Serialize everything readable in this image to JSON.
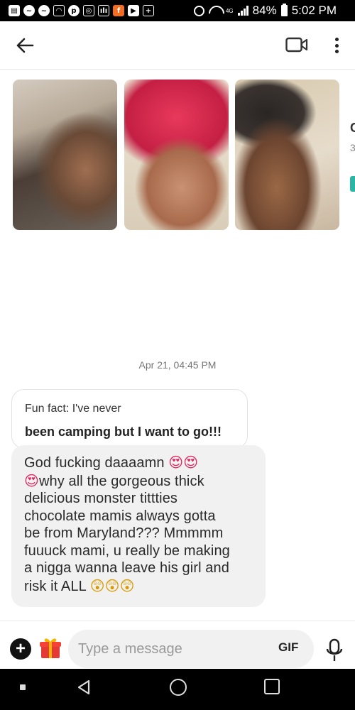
{
  "status_bar": {
    "battery": "84%",
    "time": "5:02 PM",
    "network_badge": "4G"
  },
  "header": {
    "back_icon": "arrow-left-icon",
    "video_icon": "video-camera-icon",
    "more_icon": "more-vertical-icon"
  },
  "profile": {
    "photos": [
      "photo-1",
      "photo-2",
      "photo-3"
    ],
    "peek_char": "C",
    "peek_num": "3"
  },
  "conversation": {
    "timestamp": "Apr 21, 04:45 PM",
    "prompt": {
      "question": "Fun fact: I've never",
      "answer": "been camping but I want to go!!!"
    },
    "message": {
      "line1": "God fucking daaaamn ",
      "line2": "why all the gorgeous thick",
      "line3": "delicious monster tittties",
      "line4": "chocolate mamis always gotta",
      "line5": "be from Maryland??? Mmmmm",
      "line6": "fuuuck mami, u really be making",
      "line7": "a  nigga wanna leave his girl and",
      "line8": "risk it ALL "
    }
  },
  "composer": {
    "placeholder": "Type a message",
    "gif_label": "GIF"
  },
  "colors": {
    "accent_teal": "#2bb5a5",
    "bubble_bg": "#f1f1f1",
    "gift_red": "#e53935",
    "gift_gold": "#f4b400"
  }
}
